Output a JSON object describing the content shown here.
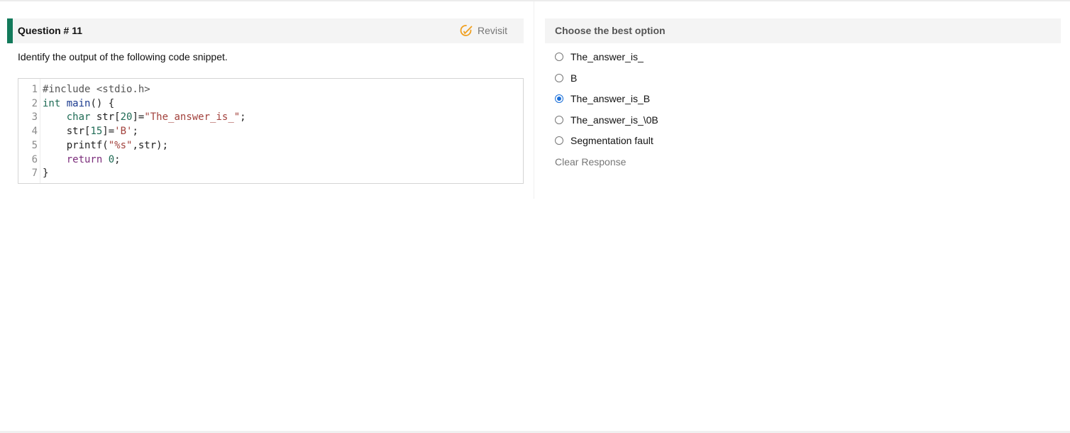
{
  "question": {
    "title": "Question # 11",
    "revisit_label": "Revisit",
    "prompt": "Identify the output of the following code snippet."
  },
  "code": {
    "line_numbers": [
      "1",
      "2",
      "3",
      "4",
      "5",
      "6",
      "7"
    ],
    "lines": [
      [
        {
          "t": "#include <stdio.h>",
          "c": "kw-pre"
        }
      ],
      [
        {
          "t": "int",
          "c": "kw-type"
        },
        {
          "t": " ",
          "c": "plain"
        },
        {
          "t": "main",
          "c": "fn"
        },
        {
          "t": "() {",
          "c": "plain"
        }
      ],
      [
        {
          "t": "    ",
          "c": "plain"
        },
        {
          "t": "char",
          "c": "kw-type"
        },
        {
          "t": " str[",
          "c": "plain"
        },
        {
          "t": "20",
          "c": "num"
        },
        {
          "t": "]=",
          "c": "plain"
        },
        {
          "t": "\"The_answer_is_\"",
          "c": "str"
        },
        {
          "t": ";",
          "c": "plain"
        }
      ],
      [
        {
          "t": "    str[",
          "c": "plain"
        },
        {
          "t": "15",
          "c": "num"
        },
        {
          "t": "]=",
          "c": "plain"
        },
        {
          "t": "'B'",
          "c": "str"
        },
        {
          "t": ";",
          "c": "plain"
        }
      ],
      [
        {
          "t": "    printf(",
          "c": "plain"
        },
        {
          "t": "\"%s\"",
          "c": "str"
        },
        {
          "t": ",str);",
          "c": "plain"
        }
      ],
      [
        {
          "t": "    ",
          "c": "plain"
        },
        {
          "t": "return",
          "c": "kw-ret"
        },
        {
          "t": " ",
          "c": "plain"
        },
        {
          "t": "0",
          "c": "num"
        },
        {
          "t": ";",
          "c": "plain"
        }
      ],
      [
        {
          "t": "}",
          "c": "plain"
        }
      ]
    ]
  },
  "options_panel": {
    "title": "Choose the best option",
    "options": [
      {
        "label": "The_answer_is_",
        "selected": false
      },
      {
        "label": "B",
        "selected": false
      },
      {
        "label": "The_answer_is_B",
        "selected": true
      },
      {
        "label": "The_answer_is_\\0B",
        "selected": false
      },
      {
        "label": "Segmentation fault",
        "selected": false
      }
    ],
    "clear_label": "Clear Response"
  },
  "colors": {
    "accent_bar": "#137a5b",
    "radio_selected": "#1a6fd9",
    "revisit_icon": "#f0a020"
  },
  "icons": {
    "revisit": "edit-circle-icon"
  }
}
